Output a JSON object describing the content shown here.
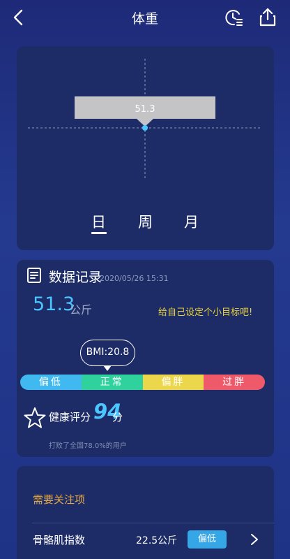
{
  "header": {
    "title": "体重",
    "back_icon": "chevron-left-icon",
    "history_icon": "clock-list-icon",
    "share_icon": "share-upload-icon"
  },
  "chart": {
    "value_label": "51.3",
    "periods": [
      "日",
      "周",
      "月"
    ],
    "selected_period": "日"
  },
  "record": {
    "title": "数据记录",
    "timestamp": "2020/05/26 15:31",
    "weight": "51.3",
    "unit": "公斤",
    "goal_link": "给自己设定个小目标吧!",
    "bmi_label": "BMI:20.8",
    "bmi_bar": [
      {
        "label": "偏低",
        "color": "#3fb9ef"
      },
      {
        "label": "正常",
        "color": "#2fd19c"
      },
      {
        "label": "偏胖",
        "color": "#ecd64b"
      },
      {
        "label": "过胖",
        "color": "#ef5a6a"
      }
    ],
    "score_label": "健康评分",
    "score_value": "94",
    "score_unit": "分",
    "beat_text": "打败了全国78.0%的用户"
  },
  "attention": {
    "title": "需要关注项",
    "items": [
      {
        "name": "骨骼肌指数",
        "value": "22.5公斤",
        "badge": "偏低"
      }
    ]
  },
  "colors": {
    "accent": "#4cc6ff",
    "goal": "#e7d23c",
    "attention": "#e3a94a"
  }
}
